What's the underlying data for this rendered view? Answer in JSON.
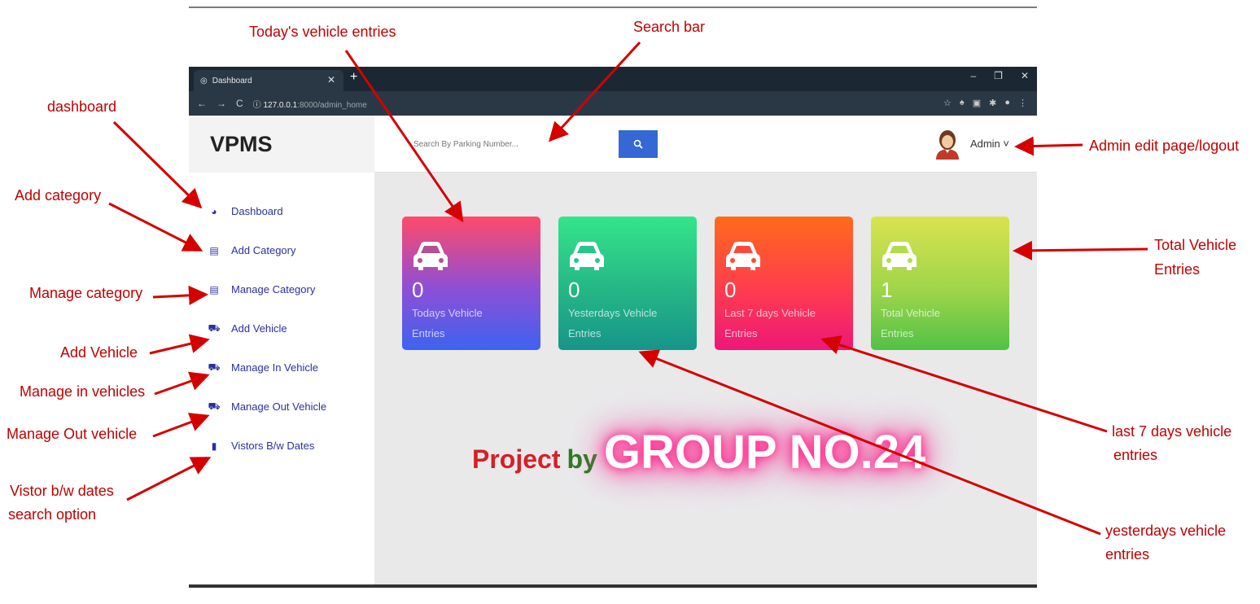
{
  "browser": {
    "tab_title": "Dashboard",
    "url_host": "127.0.0.1",
    "url_rest": ":8000/admin_home"
  },
  "app": {
    "brand": "VPMS",
    "search_placeholder": "Search By Parking Number...",
    "admin_label": "Admin ˅",
    "menu": [
      {
        "label": "Dashboard",
        "icon": "dashboard-icon"
      },
      {
        "label": "Add Category",
        "icon": "list-icon"
      },
      {
        "label": "Manage Category",
        "icon": "list-icon"
      },
      {
        "label": "Add Vehicle",
        "icon": "car-icon"
      },
      {
        "label": "Manage In Vehicle",
        "icon": "car-icon"
      },
      {
        "label": "Manage Out Vehicle",
        "icon": "car-icon"
      },
      {
        "label": "Vistors B/w Dates",
        "icon": "file-icon"
      }
    ],
    "cards": [
      {
        "count": "0",
        "label_line1": "Todays Vehicle",
        "label_line2": "Entries"
      },
      {
        "count": "0",
        "label_line1": "Yesterdays Vehicle",
        "label_line2": "Entries"
      },
      {
        "count": "0",
        "label_line1": "Last 7 days Vehicle",
        "label_line2": "Entries"
      },
      {
        "count": "1",
        "label_line1": "Total Vehicle",
        "label_line2": "Entries"
      }
    ],
    "banner": {
      "project": "Project",
      "by": "by",
      "group": "GROUP NO.24"
    }
  },
  "annotations": {
    "today_entries": "Today's vehicle entries",
    "search_bar": "Search bar",
    "dashboard": "dashboard",
    "add_category": "Add category",
    "manage_category": "Manage category",
    "add_vehicle": "Add Vehicle",
    "manage_in": "Manage in vehicles",
    "manage_out": "Manage Out vehicle",
    "visitor_line1": "Vistor b/w dates",
    "visitor_line2": "search option",
    "admin_edit": "Admin edit page/logout",
    "total_line1": "Total Vehicle",
    "total_line2": "Entries",
    "last7_line1": "last 7 days vehicle",
    "last7_line2": "entries",
    "yesterday_line1": "yesterdays vehicle",
    "yesterday_line2": "entries"
  }
}
